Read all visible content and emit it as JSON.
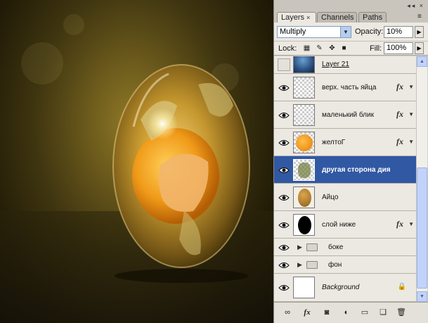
{
  "panel": {
    "tabs": [
      {
        "label": "Layers",
        "close": "×"
      },
      {
        "label": "Channels"
      },
      {
        "label": "Paths"
      }
    ],
    "window_controls": "◂◂ ×",
    "menu_icon": "≡",
    "blend_mode": "Multiply",
    "opacity_label": "Opacity:",
    "opacity_value": "10%",
    "lock_label": "Lock:",
    "fill_label": "Fill:",
    "fill_value": "100%"
  },
  "layers": [
    {
      "name": "Layer 21",
      "visible": false,
      "fx": false,
      "thumb": "earth"
    },
    {
      "name": "верх. часть яйца",
      "visible": true,
      "fx": true,
      "thumb": "transparent"
    },
    {
      "name": "маленький блик",
      "visible": true,
      "fx": true,
      "thumb": "transparent"
    },
    {
      "name": "желтоГ",
      "visible": true,
      "fx": true,
      "thumb": "yolk"
    },
    {
      "name": "другая сторона дия",
      "visible": true,
      "fx": false,
      "thumb": "map",
      "selected": true
    },
    {
      "name": "Айцо",
      "visible": true,
      "fx": false,
      "thumb": "egg"
    },
    {
      "name": "слой ниже",
      "visible": true,
      "fx": true,
      "thumb": "black-egg"
    },
    {
      "name": "боке",
      "visible": true,
      "group": true
    },
    {
      "name": "фон",
      "visible": true,
      "group": true
    },
    {
      "name": "Background",
      "visible": true,
      "thumb": "white",
      "locked": true
    }
  ],
  "bottom_icons": [
    "link-icon",
    "fx-icon",
    "mask-icon",
    "adjustment-icon",
    "folder-icon",
    "new-layer-icon",
    "trash-icon"
  ],
  "colors": {
    "selected_row": "#3158a3",
    "panel_bg": "#d4d0c8"
  }
}
